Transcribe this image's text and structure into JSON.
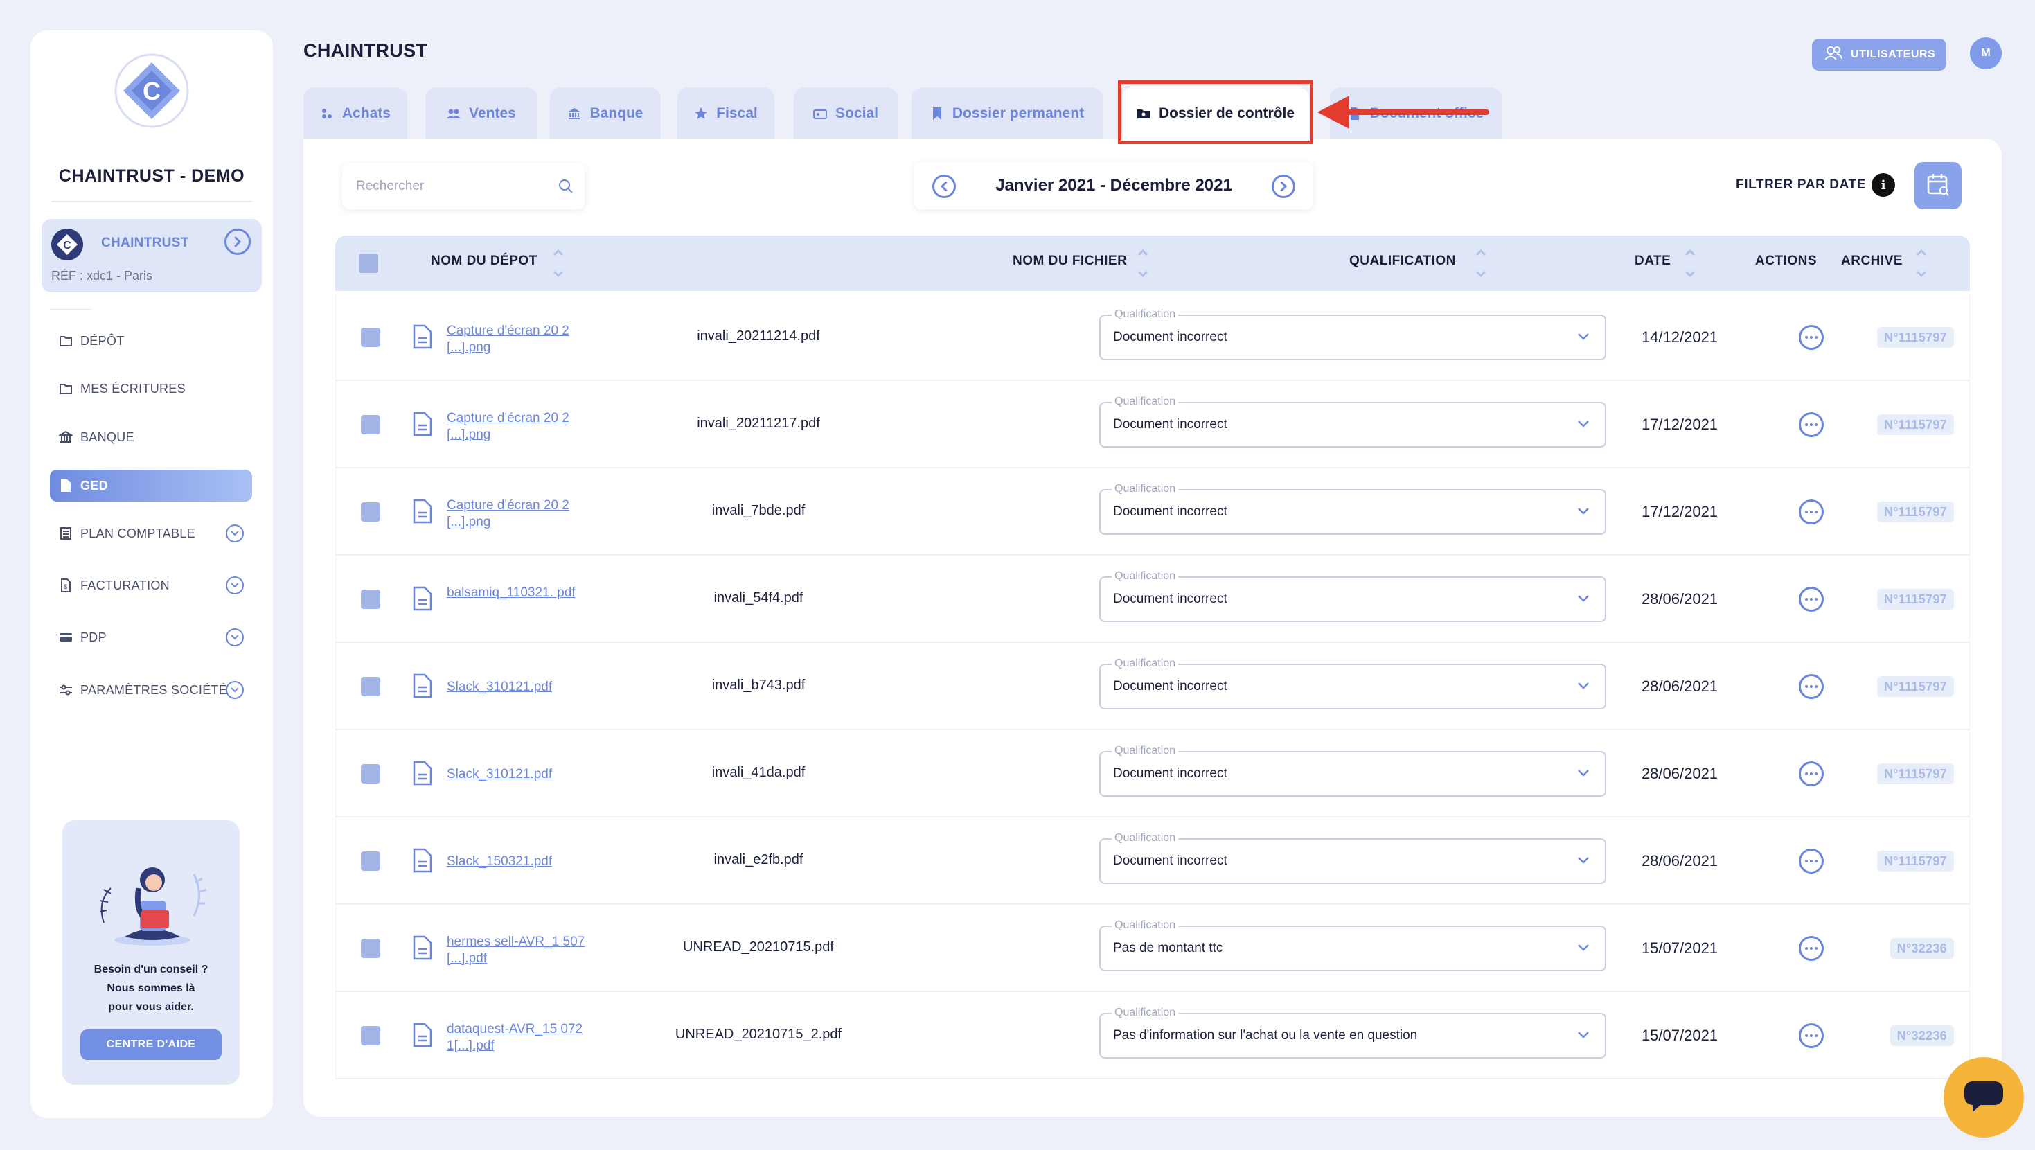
{
  "sidebar": {
    "company_name": "CHAINTRUST - DEMO",
    "org": {
      "name": "CHAINTRUST",
      "ref": "RÉF : xdc1 - Paris"
    },
    "nav": [
      {
        "label": "DÉPÔT",
        "icon": "folder-upload-icon"
      },
      {
        "label": "MES ÉCRITURES",
        "icon": "folder-edit-icon"
      },
      {
        "label": "BANQUE",
        "icon": "bank-icon"
      },
      {
        "label": "GED",
        "icon": "document-icon",
        "active": true
      },
      {
        "label": "PLAN COMPTABLE",
        "icon": "ledger-icon",
        "expandable": true
      },
      {
        "label": "FACTURATION",
        "icon": "invoice-icon",
        "expandable": true
      },
      {
        "label": "PDP",
        "icon": "card-icon",
        "expandable": true
      },
      {
        "label": "PARAMÈTRES SOCIÉTÉ",
        "icon": "sliders-icon",
        "expandable": true
      }
    ],
    "help": {
      "line1": "Besoin d'un conseil ?",
      "line2": "Nous sommes là",
      "line3": "pour vous aider.",
      "button": "CENTRE D'AIDE"
    }
  },
  "header": {
    "title": "CHAINTRUST",
    "users_button": "UTILISATEURS",
    "avatar_initial": "M"
  },
  "tabs": [
    {
      "label": "Achats",
      "icon": "purchases-icon"
    },
    {
      "label": "Ventes",
      "icon": "sales-icon"
    },
    {
      "label": "Banque",
      "icon": "bank-icon"
    },
    {
      "label": "Fiscal",
      "icon": "star-icon"
    },
    {
      "label": "Social",
      "icon": "social-icon"
    },
    {
      "label": "Dossier permanent",
      "icon": "bookmark-icon"
    },
    {
      "label": "Dossier de contrôle",
      "icon": "folder-icon",
      "active": true
    },
    {
      "label": "Document office",
      "icon": "office-icon"
    }
  ],
  "toolbar": {
    "search_placeholder": "Rechercher",
    "period": "Janvier 2021 - Décembre 2021",
    "filter_label": "FILTRER PAR DATE"
  },
  "table": {
    "headers": {
      "depot": "NOM DU DÉPOT",
      "file": "NOM DU FICHIER",
      "qualification": "QUALIFICATION",
      "date": "DATE",
      "actions": "ACTIONS",
      "archive": "ARCHIVE"
    },
    "qualification_label": "Qualification",
    "rows": [
      {
        "depot": "Capture d'écran 20 2[...].png",
        "file": "invali_20211214.pdf",
        "qualification": "Document incorrect",
        "date": "14/12/2021",
        "archive": "N°1115797"
      },
      {
        "depot": "Capture d'écran 20 2[...].png",
        "file": "invali_20211217.pdf",
        "qualification": "Document incorrect",
        "date": "17/12/2021",
        "archive": "N°1115797"
      },
      {
        "depot": "Capture d'écran 20 2[...].png",
        "file": "invali_7bde.pdf",
        "qualification": "Document incorrect",
        "date": "17/12/2021",
        "archive": "N°1115797"
      },
      {
        "depot": "balsamiq_110321. pdf",
        "file": "invali_54f4.pdf",
        "qualification": "Document incorrect",
        "date": "28/06/2021",
        "archive": "N°1115797"
      },
      {
        "depot": "Slack_310121.pdf",
        "file": "invali_b743.pdf",
        "qualification": "Document incorrect",
        "date": "28/06/2021",
        "archive": "N°1115797"
      },
      {
        "depot": "Slack_310121.pdf",
        "file": "invali_41da.pdf",
        "qualification": "Document incorrect",
        "date": "28/06/2021",
        "archive": "N°1115797"
      },
      {
        "depot": "Slack_150321.pdf",
        "file": "invali_e2fb.pdf",
        "qualification": "Document incorrect",
        "date": "28/06/2021",
        "archive": "N°1115797"
      },
      {
        "depot": "hermes sell-AVR_1 507[...].pdf",
        "file": "UNREAD_20210715.pdf",
        "qualification": "Pas de montant ttc",
        "date": "15/07/2021",
        "archive": "N°32236"
      },
      {
        "depot": "dataquest-AVR_15 0721[...].pdf",
        "file": "UNREAD_20210715_2.pdf",
        "qualification": "Pas d'information sur l'achat ou la vente en question",
        "date": "15/07/2021",
        "archive": "N°32236"
      }
    ]
  },
  "colors": {
    "accent": "#6b86db",
    "highlight": "#e33b2e",
    "chat": "#f4b53a"
  }
}
